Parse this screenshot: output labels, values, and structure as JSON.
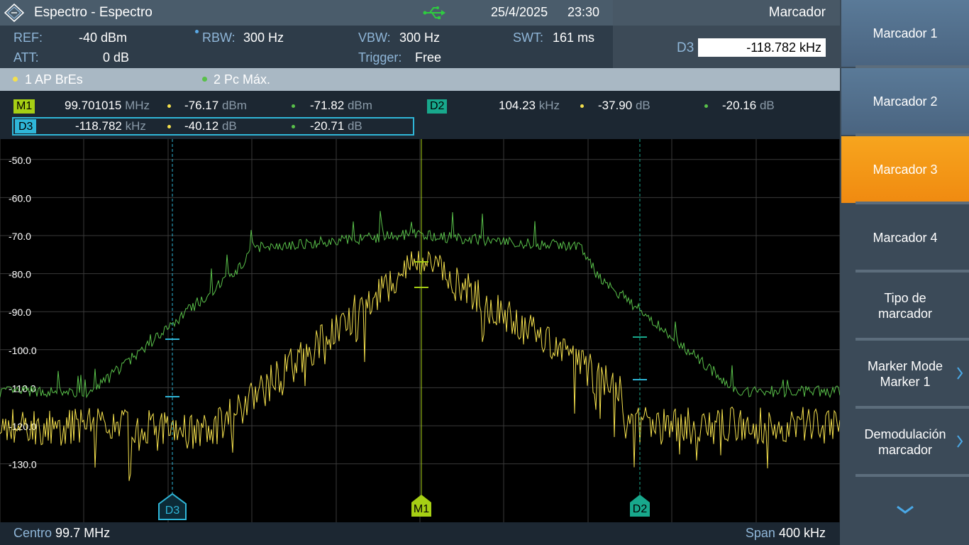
{
  "titlebar": {
    "title": "Espectro - Espectro",
    "date": "25/4/2025",
    "time": "23:30",
    "menu": "Marcador"
  },
  "settings": {
    "ref_label": "REF:",
    "ref_value": "-40 dBm",
    "att_label": "ATT:",
    "att_value": "0 dB",
    "rbw_label": "RBW:",
    "rbw_value": "300 Hz",
    "vbw_label": "VBW:",
    "vbw_value": "300 Hz",
    "trigger_label": "Trigger:",
    "trigger_value": "Free",
    "swt_label": "SWT:",
    "swt_value": "161 ms"
  },
  "delta_input": {
    "label": "D3",
    "value": "-118.782 kHz"
  },
  "traces": [
    {
      "label": "1 AP  BrEs",
      "color": "#f4e04d"
    },
    {
      "label": "2 Pc  Máx.",
      "color": "#59c04a"
    }
  ],
  "markers": {
    "m1": {
      "name": "M1",
      "freq": "99.701015",
      "freq_unit": "MHz",
      "t1": "-76.17",
      "t1_unit": "dBm",
      "t2": "-71.82",
      "t2_unit": "dBm"
    },
    "d2": {
      "name": "D2",
      "freq": "104.23",
      "freq_unit": "kHz",
      "t1": "-37.90",
      "t1_unit": "dB",
      "t2": "-20.16",
      "t2_unit": "dB"
    },
    "d3": {
      "name": "D3",
      "freq": "-118.782",
      "freq_unit": "kHz",
      "t1": "-40.12",
      "t1_unit": "dB",
      "t2": "-20.71",
      "t2_unit": "dB"
    }
  },
  "plot": {
    "y_ticks": [
      "-50.0",
      "-60.0",
      "-70.0",
      "-80.0",
      "-90.0",
      "-100.0",
      "-110.0",
      "-120.0",
      "-130.0"
    ],
    "marker_tags": [
      "D3",
      "M1",
      "D2"
    ]
  },
  "bottombar": {
    "center_label": "Centro",
    "center_value": "99.7 MHz",
    "span_label": "Span",
    "span_value": "400 kHz"
  },
  "softkeys": [
    "Marcador 1",
    "Marcador 2",
    "Marcador 3",
    "Marcador 4",
    "Tipo de\nmarcador",
    "Marker Mode\nMarker 1",
    "Demodulación\nmarcador"
  ],
  "colors": {
    "accent": "#f39a18",
    "trace1": "#f4e04d",
    "trace2": "#59c04a",
    "m1": "#a6cf14",
    "d2": "#18a88c",
    "d3": "#2fb6d8"
  }
}
